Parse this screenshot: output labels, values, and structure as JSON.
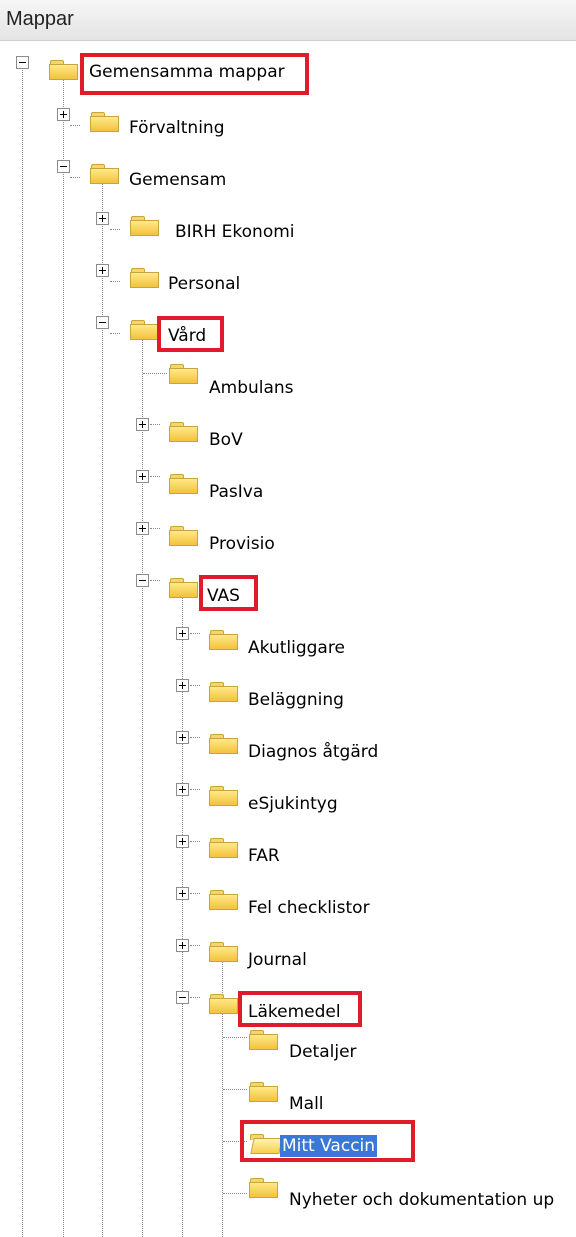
{
  "panel": {
    "title": "Mappar"
  },
  "tree": {
    "root": "Gemensamma mappar",
    "forvaltning": "Förvaltning",
    "gemensam": "Gemensam",
    "birh": "BIRH Ekonomi",
    "personal": "Personal",
    "vard": "Vård",
    "ambulans": "Ambulans",
    "bov": "BoV",
    "pasiva": "PasIva",
    "provisio": "Provisio",
    "vas": "VAS",
    "akutliggare": "Akutliggare",
    "belaggning": "Beläggning",
    "diagnos": "Diagnos åtgärd",
    "esjukintyg": "eSjukintyg",
    "far": "FAR",
    "felchecklistor": "Fel checklistor",
    "journal": "Journal",
    "lakemedel": "Läkemedel",
    "detaljer": "Detaljer",
    "mall": "Mall",
    "mittvaccin": "Mitt Vaccin",
    "nyheter": "Nyheter och dokumentation up"
  },
  "colors": {
    "highlight": "#e01b2a",
    "selection": "#3a78d6"
  }
}
